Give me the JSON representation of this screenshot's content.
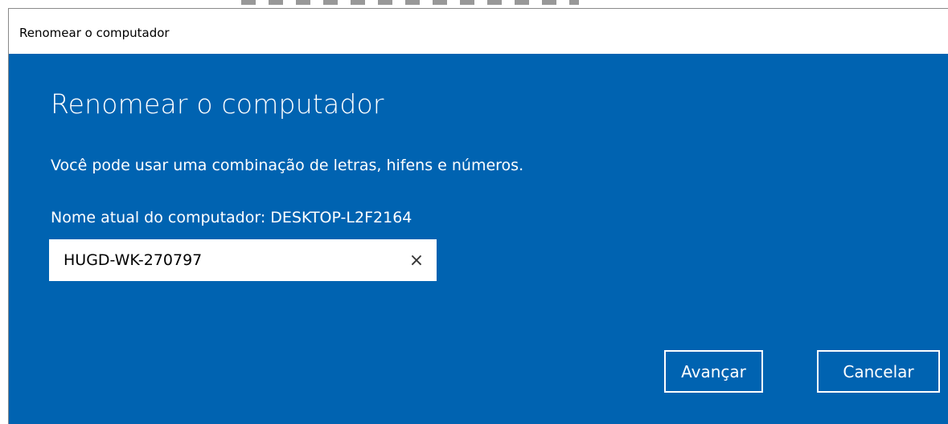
{
  "window": {
    "title": "Renomear o computador"
  },
  "dialog": {
    "heading": "Renomear o computador",
    "description": "Você pode usar uma combinação de letras, hifens e números.",
    "current_name_label": "Nome atual do computador: DESKTOP-L2F2164",
    "name_input_value": "HUGD-WK-270797",
    "clear_icon_glyph": "×",
    "clear_icon": "close-icon"
  },
  "buttons": {
    "next_label": "Avançar",
    "cancel_label": "Cancelar"
  },
  "colors": {
    "dialog_background": "#0063b1",
    "text": "#ffffff",
    "titlebar": "#ffffff"
  }
}
